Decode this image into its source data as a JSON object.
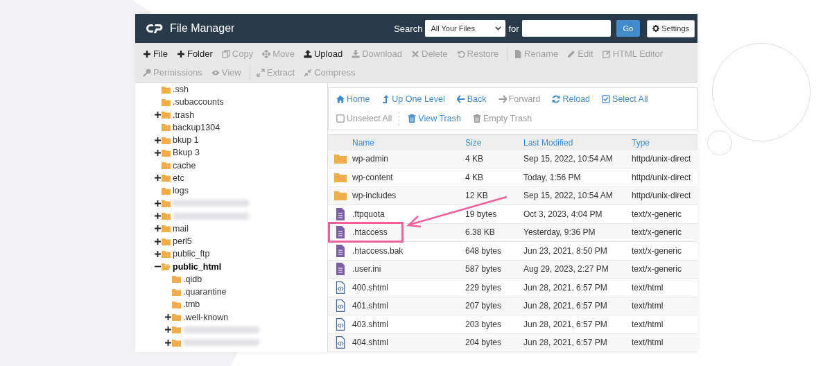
{
  "header": {
    "title": "File Manager",
    "search_label": "Search",
    "search_scope": "All Your Files",
    "for_label": "for",
    "go_button": "Go",
    "settings_button": "Settings"
  },
  "toolbar": [
    {
      "label": "File",
      "kind": "plus",
      "disabled": false,
      "divider_before": false
    },
    {
      "label": "Folder",
      "kind": "plus",
      "disabled": false,
      "divider_before": false
    },
    {
      "label": "Copy",
      "kind": "copy",
      "disabled": true,
      "divider_before": false
    },
    {
      "label": "Move",
      "kind": "move",
      "disabled": true,
      "divider_before": false
    },
    {
      "label": "Upload",
      "kind": "upload",
      "disabled": false,
      "divider_before": false
    },
    {
      "label": "Download",
      "kind": "download",
      "disabled": true,
      "divider_before": false
    },
    {
      "label": "Delete",
      "kind": "delete",
      "disabled": true,
      "divider_before": false
    },
    {
      "label": "Restore",
      "kind": "restore",
      "disabled": true,
      "divider_before": false
    },
    {
      "label": "Rename",
      "kind": "rename",
      "disabled": true,
      "divider_before": true
    },
    {
      "label": "Edit",
      "kind": "edit",
      "disabled": true,
      "divider_before": false
    },
    {
      "label": "HTML Editor",
      "kind": "htmleditor",
      "disabled": true,
      "divider_before": false
    },
    {
      "label": "Permissions",
      "kind": "permissions",
      "disabled": true,
      "divider_before": false
    },
    {
      "label": "View",
      "kind": "view",
      "disabled": true,
      "divider_before": false
    },
    {
      "label": "Extract",
      "kind": "extract",
      "disabled": true,
      "divider_before": true
    },
    {
      "label": "Compress",
      "kind": "compress",
      "disabled": true,
      "divider_before": false
    }
  ],
  "tree": [
    {
      "kind": "folder",
      "label": ".ssh",
      "expandable": false,
      "expanded": false,
      "selected": false
    },
    {
      "kind": "folder",
      "label": ".subaccounts",
      "expandable": false,
      "expanded": false,
      "selected": false
    },
    {
      "kind": "folder",
      "label": ".trash",
      "expandable": true,
      "expanded": false,
      "selected": false
    },
    {
      "kind": "folder",
      "label": "backup1304",
      "expandable": false,
      "expanded": false,
      "selected": false
    },
    {
      "kind": "folder",
      "label": "bkup 1",
      "expandable": true,
      "expanded": false,
      "selected": false
    },
    {
      "kind": "folder",
      "label": "Bkup 3",
      "expandable": true,
      "expanded": false,
      "selected": false
    },
    {
      "kind": "folder",
      "label": "cache",
      "expandable": false,
      "expanded": false,
      "selected": false
    },
    {
      "kind": "folder",
      "label": "etc",
      "expandable": true,
      "expanded": false,
      "selected": false
    },
    {
      "kind": "folder",
      "label": "logs",
      "expandable": false,
      "expanded": false,
      "selected": false
    },
    {
      "kind": "redacted",
      "expandable": true,
      "expanded": false,
      "selected": false
    },
    {
      "kind": "redacted",
      "expandable": true,
      "expanded": false,
      "selected": false
    },
    {
      "kind": "folder",
      "label": "mail",
      "expandable": true,
      "expanded": false,
      "selected": false
    },
    {
      "kind": "folder",
      "label": "perl5",
      "expandable": true,
      "expanded": false,
      "selected": false
    },
    {
      "kind": "folder",
      "label": "public_ftp",
      "expandable": true,
      "expanded": false,
      "selected": false
    },
    {
      "kind": "folder",
      "label": "public_html",
      "expandable": true,
      "expanded": true,
      "selected": true,
      "children": [
        {
          "kind": "folder",
          "label": ".qidb",
          "expandable": false,
          "expanded": false,
          "selected": false
        },
        {
          "kind": "folder",
          "label": ".quarantine",
          "expandable": false,
          "expanded": false,
          "selected": false
        },
        {
          "kind": "folder",
          "label": ".tmb",
          "expandable": false,
          "expanded": false,
          "selected": false
        },
        {
          "kind": "folder",
          "label": ".well-known",
          "expandable": true,
          "expanded": false,
          "selected": false
        },
        {
          "kind": "redacted",
          "expandable": true,
          "expanded": false,
          "selected": false
        },
        {
          "kind": "redacted",
          "expandable": true,
          "expanded": false,
          "selected": false
        }
      ]
    }
  ],
  "nav": [
    {
      "label": "Home",
      "kind": "home",
      "disabled": false,
      "divider_before": false
    },
    {
      "label": "Up One Level",
      "kind": "up",
      "disabled": false,
      "divider_before": false
    },
    {
      "label": "Back",
      "kind": "back",
      "disabled": false,
      "divider_before": false
    },
    {
      "label": "Forward",
      "kind": "forward",
      "disabled": true,
      "divider_before": false
    },
    {
      "label": "Reload",
      "kind": "reload",
      "disabled": false,
      "divider_before": false
    },
    {
      "label": "Select All",
      "kind": "selectall",
      "disabled": false,
      "divider_before": false
    },
    {
      "label": "Unselect All",
      "kind": "unselectall",
      "disabled": true,
      "divider_before": false
    },
    {
      "label": "View Trash",
      "kind": "trash",
      "disabled": false,
      "divider_before": true
    },
    {
      "label": "Empty Trash",
      "kind": "trash",
      "disabled": true,
      "divider_before": false
    }
  ],
  "table": {
    "columns": [
      "Name",
      "Size",
      "Last Modified",
      "Type"
    ],
    "rows": [
      {
        "kind": "folder",
        "name": "wp-admin",
        "size": "4 KB",
        "modified": "Sep 15, 2022, 10:54 AM",
        "type": "httpd/unix-direct",
        "highlighted": false
      },
      {
        "kind": "folder",
        "name": "wp-content",
        "size": "4 KB",
        "modified": "Today, 1:56 PM",
        "type": "httpd/unix-direct",
        "highlighted": false
      },
      {
        "kind": "folder",
        "name": "wp-includes",
        "size": "12 KB",
        "modified": "Sep 15, 2022, 10:54 AM",
        "type": "httpd/unix-direct",
        "highlighted": false
      },
      {
        "kind": "text",
        "name": ".ftpquota",
        "size": "19 bytes",
        "modified": "Oct 3, 2023, 4:04 PM",
        "type": "text/x-generic",
        "highlighted": false
      },
      {
        "kind": "text",
        "name": ".htaccess",
        "size": "6.38 KB",
        "modified": "Yesterday, 9:36 PM",
        "type": "text/x-generic",
        "highlighted": true
      },
      {
        "kind": "text",
        "name": ".htaccess.bak",
        "size": "648 bytes",
        "modified": "Jun 23, 2021, 8:50 PM",
        "type": "text/x-generic",
        "highlighted": false
      },
      {
        "kind": "text",
        "name": ".user.ini",
        "size": "587 bytes",
        "modified": "Aug 29, 2023, 2:27 PM",
        "type": "text/x-generic",
        "highlighted": false
      },
      {
        "kind": "html",
        "name": "400.shtml",
        "size": "229 bytes",
        "modified": "Jun 28, 2021, 6:57 PM",
        "type": "text/html",
        "highlighted": false
      },
      {
        "kind": "html",
        "name": "401.shtml",
        "size": "207 bytes",
        "modified": "Jun 28, 2021, 6:57 PM",
        "type": "text/html",
        "highlighted": false
      },
      {
        "kind": "html",
        "name": "403.shtml",
        "size": "203 bytes",
        "modified": "Jun 28, 2021, 6:57 PM",
        "type": "text/html",
        "highlighted": false
      },
      {
        "kind": "html",
        "name": "404.shtml",
        "size": "204 bytes",
        "modified": "Jun 28, 2021, 6:57 PM",
        "type": "text/html",
        "highlighted": false
      }
    ]
  }
}
